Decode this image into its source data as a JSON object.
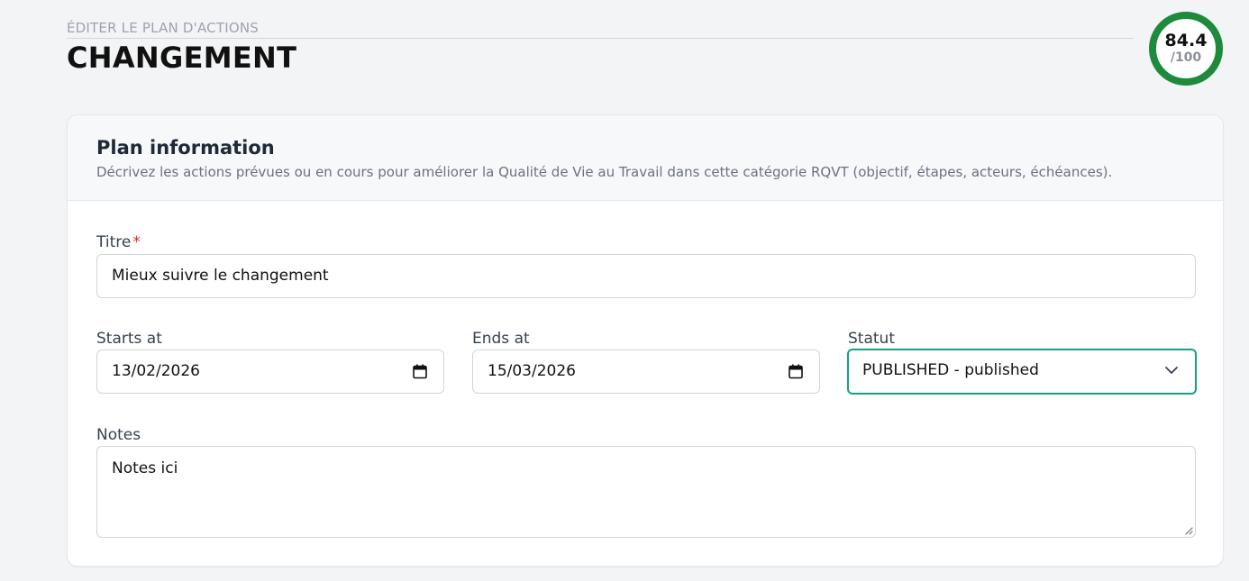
{
  "header": {
    "eyebrow": "ÉDITER LE PLAN D'ACTIONS",
    "title": "CHANGEMENT"
  },
  "score": {
    "value": "84.4",
    "max": "/100",
    "ring_color": "#1e8a3c"
  },
  "card": {
    "title": "Plan information",
    "description": "Décrivez les actions prévues ou en cours pour améliorer la Qualité de Vie au Travail dans cette catégorie RQVT (objectif, étapes, acteurs, échéances)."
  },
  "form": {
    "title": {
      "label": "Titre",
      "required_mark": "*",
      "value": "Mieux suivre le changement"
    },
    "starts_at": {
      "label": "Starts at",
      "value": "13/02/2026"
    },
    "ends_at": {
      "label": "Ends at",
      "value": "15/03/2026"
    },
    "status": {
      "label": "Statut",
      "value": "PUBLISHED - published",
      "focus_color": "#16a085"
    },
    "notes": {
      "label": "Notes",
      "value": "Notes ici"
    }
  },
  "icons": {
    "date_picker": "calendar-icon",
    "dropdown": "chevron-down-icon",
    "resize": "resize-handle-icon"
  }
}
